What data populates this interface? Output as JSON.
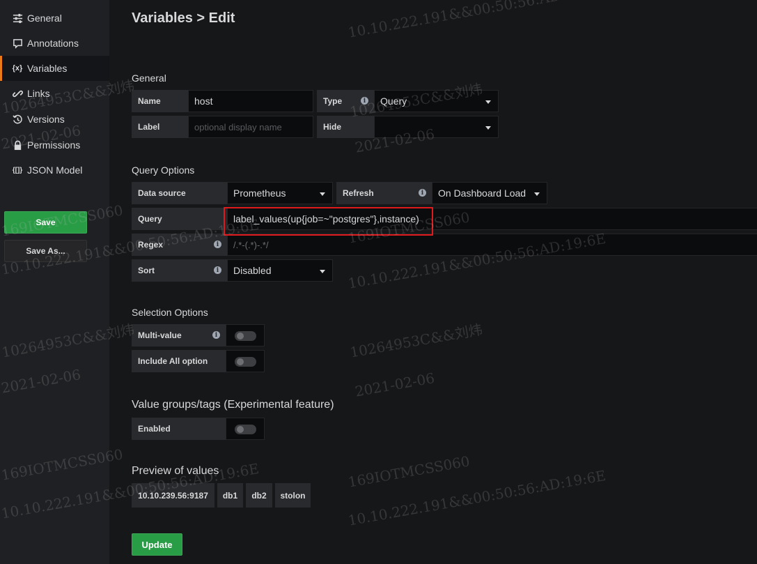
{
  "sidebar": {
    "items": [
      {
        "label": "General",
        "icon": "sliders-icon"
      },
      {
        "label": "Annotations",
        "icon": "comment-icon"
      },
      {
        "label": "Variables",
        "icon": "variable-icon",
        "icon_text": "{x}"
      },
      {
        "label": "Links",
        "icon": "link-icon"
      },
      {
        "label": "Versions",
        "icon": "history-icon"
      },
      {
        "label": "Permissions",
        "icon": "lock-icon"
      },
      {
        "label": "JSON Model",
        "icon": "json-icon",
        "icon_text": "{[]}"
      }
    ],
    "active_index": 2,
    "save_label": "Save",
    "save_as_label": "Save As..."
  },
  "page": {
    "title": "Variables > Edit"
  },
  "general": {
    "heading": "General",
    "name_label": "Name",
    "name_value": "host",
    "type_label": "Type",
    "type_value": "Query",
    "label_label": "Label",
    "label_placeholder": "optional display name",
    "hide_label": "Hide",
    "hide_value": ""
  },
  "query_options": {
    "heading": "Query Options",
    "datasource_label": "Data source",
    "datasource_value": "Prometheus",
    "refresh_label": "Refresh",
    "refresh_value": "On Dashboard Load",
    "query_label": "Query",
    "query_value": "label_values(up{job=~\"postgres\"},instance)",
    "regex_label": "Regex",
    "regex_placeholder": "/.*-(.*)-.*/",
    "sort_label": "Sort",
    "sort_value": "Disabled"
  },
  "selection_options": {
    "heading": "Selection Options",
    "multi_value_label": "Multi-value",
    "include_all_label": "Include All option"
  },
  "value_groups": {
    "heading": "Value groups/tags (Experimental feature)",
    "enabled_label": "Enabled"
  },
  "preview": {
    "heading": "Preview of values",
    "values": [
      "10.10.239.56:9187",
      "db1",
      "db2",
      "stolon"
    ]
  },
  "update_label": "Update",
  "watermarks": {
    "line_ip": "10.10.222.191&&00:50:56:AD:19:6E",
    "line_id": "10264953C&&刘炜",
    "line_date": "2021-02-06",
    "line_code": "169IOTMCSS060"
  },
  "colors": {
    "accent": "#eb7b18",
    "save_green": "#299c46",
    "highlight_red": "#e0191c"
  }
}
